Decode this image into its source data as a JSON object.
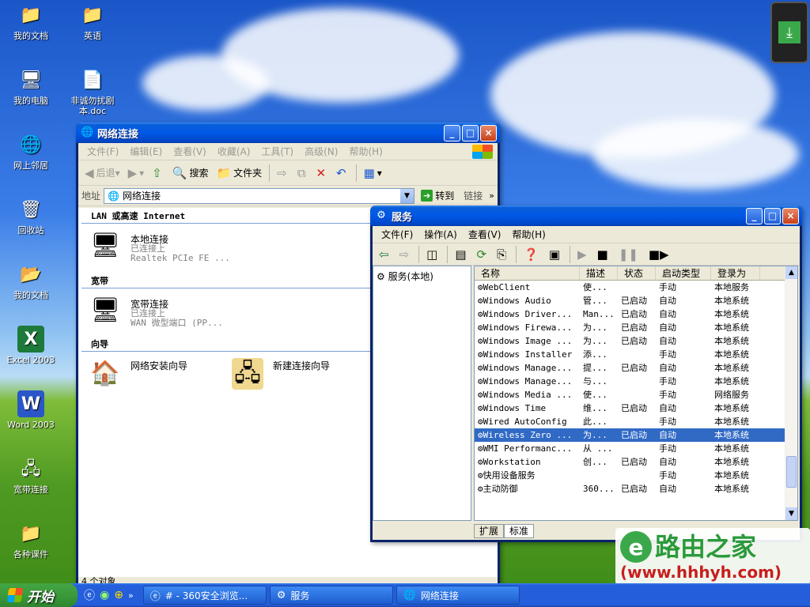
{
  "desktop_icons": [
    {
      "label": "我的文档",
      "icon": "folder-documents-icon"
    },
    {
      "label": "英语",
      "icon": "folder-icon"
    },
    {
      "label": "我的电脑",
      "icon": "computer-icon"
    },
    {
      "label": "非诚勿扰剧本.doc",
      "icon": "document-icon"
    },
    {
      "label": "网上邻居",
      "icon": "network-icon"
    },
    {
      "label": "回收站",
      "icon": "recycle-bin-icon"
    },
    {
      "label": "我的文档",
      "icon": "folder-shortcut-icon"
    },
    {
      "label": "Excel 2003",
      "icon": "excel-icon"
    },
    {
      "label": "Word 2003",
      "icon": "word-icon"
    },
    {
      "label": "宽带连接",
      "icon": "broadband-icon"
    },
    {
      "label": "各种课件",
      "icon": "folder-icon"
    }
  ],
  "net_window": {
    "title": "网络连接",
    "menu": [
      "文件(F)",
      "编辑(E)",
      "查看(V)",
      "收藏(A)",
      "工具(T)",
      "高级(N)",
      "帮助(H)"
    ],
    "toolbar": {
      "back": "后退",
      "search": "搜索",
      "folders": "文件夹"
    },
    "address_label": "地址",
    "address_value": "网络连接",
    "go_label": "转到",
    "links_label": "链接",
    "groups": {
      "lan": "LAN 或高速 Internet",
      "broadband": "宽带",
      "wizard": "向导"
    },
    "lan_conn": {
      "name": "本地连接",
      "status": "已连接上",
      "device": "Realtek PCIe FE ..."
    },
    "bb_conn": {
      "name": "宽带连接",
      "status": "已连接上",
      "device": "WAN 微型端口 (PP..."
    },
    "wizards": {
      "setup": "网络安装向导",
      "new": "新建连接向导"
    },
    "status_text": "4 个对象"
  },
  "svc_window": {
    "title": "服务",
    "menu": [
      "文件(F)",
      "操作(A)",
      "查看(V)",
      "帮助(H)"
    ],
    "tree_root": "服务(本地)",
    "columns": [
      "名称",
      "描述",
      "状态",
      "启动类型",
      "登录为"
    ],
    "rows": [
      [
        "WebClient",
        "使...",
        "",
        "手动",
        "本地服务"
      ],
      [
        "Windows Audio",
        "管...",
        "已启动",
        "自动",
        "本地系统"
      ],
      [
        "Windows Driver...",
        "Man...",
        "已启动",
        "自动",
        "本地系统"
      ],
      [
        "Windows Firewa...",
        "为...",
        "已启动",
        "自动",
        "本地系统"
      ],
      [
        "Windows Image ...",
        "为...",
        "已启动",
        "自动",
        "本地系统"
      ],
      [
        "Windows Installer",
        "添...",
        "",
        "手动",
        "本地系统"
      ],
      [
        "Windows Manage...",
        "提...",
        "已启动",
        "自动",
        "本地系统"
      ],
      [
        "Windows Manage...",
        "与...",
        "",
        "手动",
        "本地系统"
      ],
      [
        "Windows Media ...",
        "使...",
        "",
        "手动",
        "网络服务"
      ],
      [
        "Windows Time",
        "维...",
        "已启动",
        "自动",
        "本地系统"
      ],
      [
        "Wired AutoConfig",
        "此...",
        "",
        "手动",
        "本地系统"
      ],
      [
        "Wireless Zero ...",
        "为...",
        "已启动",
        "自动",
        "本地系统"
      ],
      [
        "WMI Performanc...",
        "从 ...",
        "",
        "手动",
        "本地系统"
      ],
      [
        "Workstation",
        "创...",
        "已启动",
        "自动",
        "本地系统"
      ],
      [
        "快用设备服务",
        "",
        "",
        "手动",
        "本地系统"
      ],
      [
        "主动防御",
        "360...",
        "已启动",
        "自动",
        "本地系统"
      ]
    ],
    "selected_row": 11,
    "tabs": [
      "扩展",
      "标准"
    ]
  },
  "taskbar": {
    "start": "开始",
    "tasks": [
      "# - 360安全浏览...",
      "服务",
      "网络连接"
    ]
  },
  "watermark": {
    "brand": "路由之家",
    "url": "(www.hhhyh.com)"
  }
}
